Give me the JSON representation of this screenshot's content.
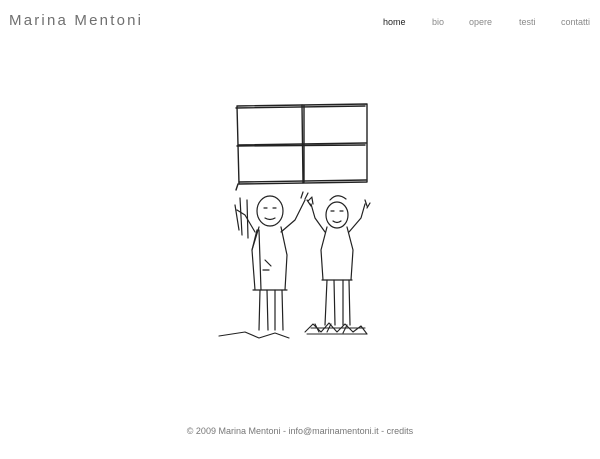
{
  "header": {
    "site_title": "Marina Mentoni"
  },
  "nav": {
    "items": [
      {
        "label": "home",
        "active": true
      },
      {
        "label": "bio",
        "active": false
      },
      {
        "label": "opere",
        "active": false
      },
      {
        "label": "testi",
        "active": false
      },
      {
        "label": "contatti",
        "active": false
      }
    ]
  },
  "footer": {
    "copyright": "© 2009 Marina Mentoni",
    "separator1": " - ",
    "email": "info@marinamentoni.it",
    "separator2": " - ",
    "credits": "credits"
  }
}
